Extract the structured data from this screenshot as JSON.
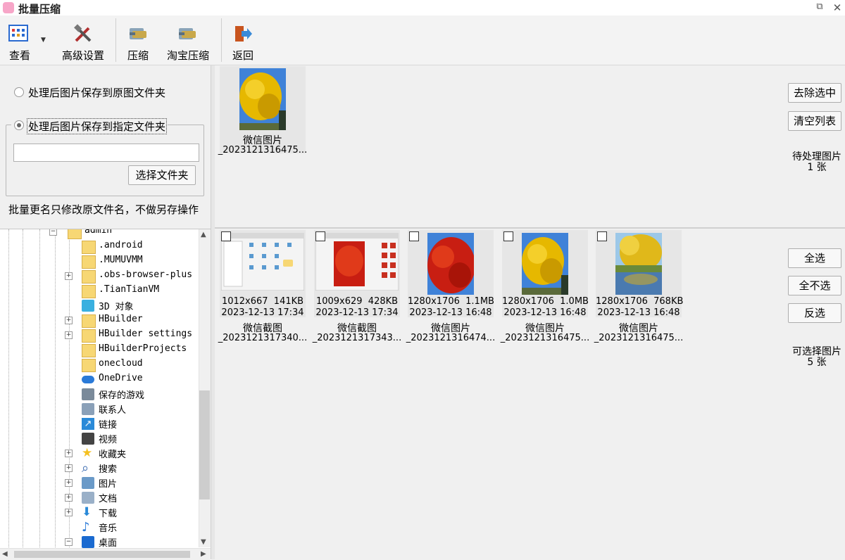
{
  "window": {
    "title": "批量压缩",
    "restore_glyph": "⧉",
    "close_glyph": "✕"
  },
  "toolbar": {
    "view_label": "查看",
    "advanced_label": "高级设置",
    "compress_label": "压缩",
    "taobao_label": "淘宝压缩",
    "back_label": "返回"
  },
  "options": {
    "save_original_label": "处理后图片保存到原图文件夹",
    "save_custom_label": "处理后图片保存到指定文件夹",
    "folder_value": "",
    "choose_folder_label": "选择文件夹",
    "note": "批量更名只修改原文件名，不做另存操作"
  },
  "tree": {
    "items": [
      {
        "label": "admin",
        "icon": "folder-icon",
        "expander": "⊟"
      },
      {
        "label": ".android",
        "icon": "folder-icon",
        "expander": ""
      },
      {
        "label": ".MUMUVMM",
        "icon": "folder-icon",
        "expander": ""
      },
      {
        "label": ".obs-browser-plus",
        "icon": "folder-icon",
        "expander": "+"
      },
      {
        "label": ".TianTianVM",
        "icon": "folder-icon",
        "expander": ""
      },
      {
        "label": "3D 对象",
        "icon": "3d-objects-icon",
        "expander": ""
      },
      {
        "label": "HBuilder",
        "icon": "folder-icon",
        "expander": "+"
      },
      {
        "label": "HBuilder settings",
        "icon": "folder-icon",
        "expander": "+"
      },
      {
        "label": "HBuilderProjects",
        "icon": "folder-icon",
        "expander": ""
      },
      {
        "label": "onecloud",
        "icon": "folder-icon",
        "expander": ""
      },
      {
        "label": "OneDrive",
        "icon": "cloud-icon",
        "expander": ""
      },
      {
        "label": "保存的游戏",
        "icon": "games-icon",
        "expander": ""
      },
      {
        "label": "联系人",
        "icon": "contacts-icon",
        "expander": ""
      },
      {
        "label": "链接",
        "icon": "link-icon",
        "expander": ""
      },
      {
        "label": "视频",
        "icon": "video-icon",
        "expander": ""
      },
      {
        "label": "收藏夹",
        "icon": "star-icon",
        "expander": "+"
      },
      {
        "label": "搜索",
        "icon": "search-icon",
        "expander": "+"
      },
      {
        "label": "图片",
        "icon": "pictures-icon",
        "expander": "+"
      },
      {
        "label": "文档",
        "icon": "documents-icon",
        "expander": "+"
      },
      {
        "label": "下载",
        "icon": "download-icon",
        "expander": "+"
      },
      {
        "label": "音乐",
        "icon": "music-icon",
        "expander": ""
      },
      {
        "label": "桌面",
        "icon": "desktop-icon",
        "expander": "⊟"
      }
    ]
  },
  "pending": {
    "items": [
      {
        "name": "微信图片",
        "filename": "_2023121316475...",
        "thumb": "yellow-tree"
      }
    ],
    "remove_selected_label": "去除选中",
    "clear_list_label": "清空列表",
    "count_label": "待处理图片",
    "count_value": "1 张"
  },
  "available": {
    "items": [
      {
        "name": "微信截图",
        "filename": "_2023121317340...",
        "dimensions": "1012x667",
        "size": "141KB",
        "date": "2023-12-13 17:34",
        "thumb": "screenshot-a"
      },
      {
        "name": "微信截图",
        "filename": "_2023121317343...",
        "dimensions": "1009x629",
        "size": "428KB",
        "date": "2023-12-13 17:34",
        "thumb": "screenshot-b"
      },
      {
        "name": "微信图片",
        "filename": "_2023121316474...",
        "dimensions": "1280x1706",
        "size": "1.1MB",
        "date": "2023-12-13 16:48",
        "thumb": "red-tree"
      },
      {
        "name": "微信图片",
        "filename": "_2023121316475...",
        "dimensions": "1280x1706",
        "size": "1.0MB",
        "date": "2023-12-13 16:48",
        "thumb": "yellow-tree"
      },
      {
        "name": "微信图片",
        "filename": "_2023121316475...",
        "dimensions": "1280x1706",
        "size": "768KB",
        "date": "2023-12-13 16:48",
        "thumb": "willow-lake"
      }
    ],
    "select_all_label": "全选",
    "select_none_label": "全不选",
    "invert_label": "反选",
    "count_label": "可选择图片",
    "count_value": "5 张"
  },
  "colors": {
    "folder": "#f7d774",
    "sky": "#3f82d8",
    "yellow_leaf": "#e6b800",
    "red_leaf": "#c81e12"
  }
}
